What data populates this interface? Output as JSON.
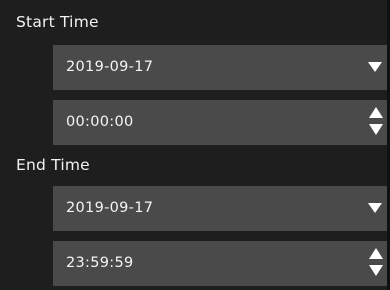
{
  "start_time": {
    "label": "Start Time",
    "date": "2019-09-17",
    "time": "00:00:00"
  },
  "end_time": {
    "label": "End Time",
    "date": "2019-09-17",
    "time": "23:59:59"
  },
  "icons": {
    "dropdown": "chevron-down-icon",
    "spinner_up": "spin-up-icon",
    "spinner_down": "spin-down-icon"
  },
  "colors": {
    "background": "#1e1e1e",
    "field_background": "#4a4a4a",
    "text": "#ffffff"
  }
}
